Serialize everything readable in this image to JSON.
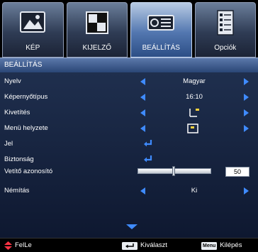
{
  "tabs": [
    {
      "label": "KÉP",
      "icon": "picture-icon",
      "active": false
    },
    {
      "label": "KIJELZŐ",
      "icon": "display-icon",
      "active": false
    },
    {
      "label": "BEÁLLÍTÁS",
      "icon": "projector-icon",
      "active": true
    },
    {
      "label": "Opciók",
      "icon": "options-icon",
      "active": false
    }
  ],
  "header": {
    "title": "BEÁLLÍTÁS"
  },
  "menu": {
    "rows": [
      {
        "label": "Nyelv",
        "value": "Magyar"
      },
      {
        "label": "Képernyőtípus",
        "value": "16:10"
      },
      {
        "label": "Kivetítés",
        "value_icon": "projection-mode-icon"
      },
      {
        "label": "Menü helyzete",
        "value_icon": "menu-position-icon"
      },
      {
        "label": "Jel",
        "value_icon": "enter-icon"
      },
      {
        "label": "Biztonság",
        "value_icon": "enter-icon"
      },
      {
        "label": "Vetítő azonosító",
        "slider_value": "50",
        "slider_fraction": 0.5
      },
      {
        "label": "Némítás",
        "value": "Ki"
      }
    ]
  },
  "footer": {
    "back": "FelLe",
    "select": "Kiválaszt",
    "menu_key": "Menu",
    "exit": "Kilépés"
  },
  "colors": {
    "accent_arrow": "#3f8bff",
    "active_tab": "#5377b0",
    "panel_bg": "#1f2f4e"
  }
}
